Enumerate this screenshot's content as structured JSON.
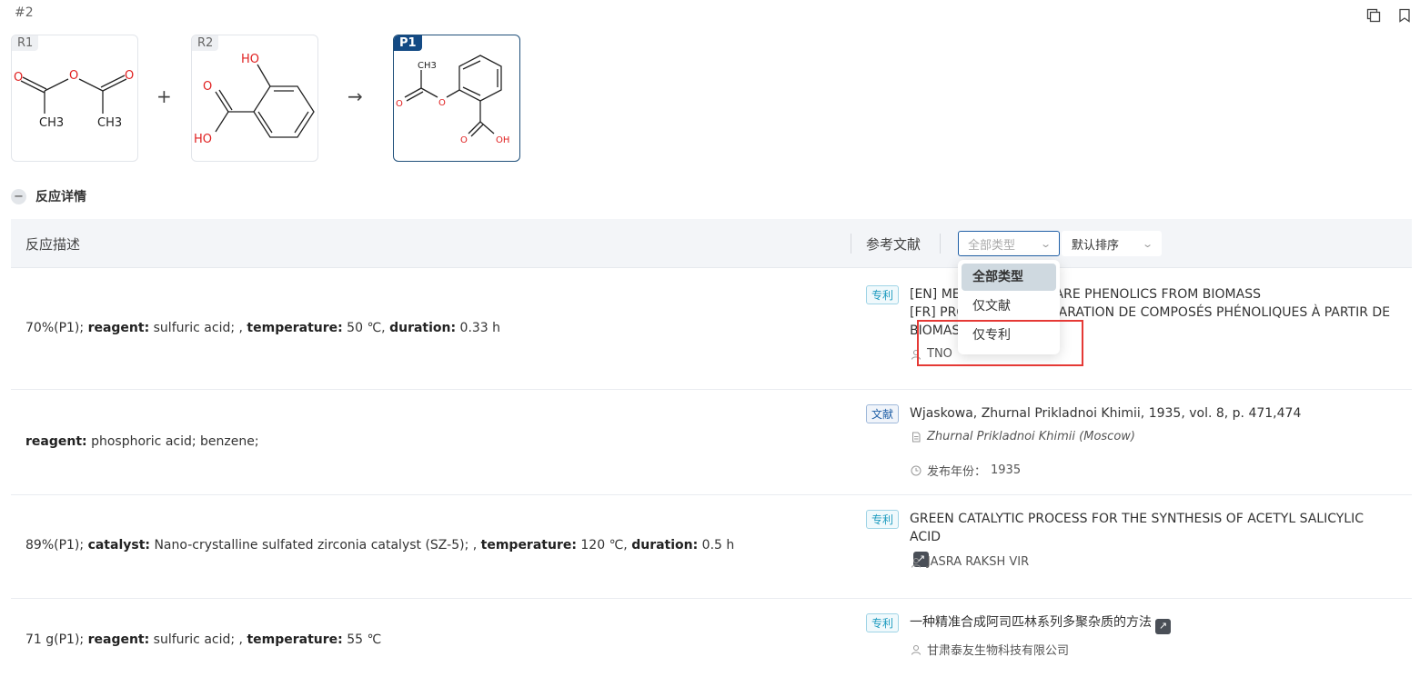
{
  "header": {
    "index": "#2",
    "copy_icon": "copy-icon",
    "bookmark_icon": "bookmark-icon"
  },
  "scheme": {
    "r1_label": "R1",
    "r2_label": "R2",
    "p1_label": "P1",
    "plus": "+",
    "arrow": "→",
    "atoms": {
      "O": "O",
      "CH3": "CH3",
      "HO": "HO",
      "OH": "OH"
    }
  },
  "section": {
    "title": "反应详情",
    "toggle_symbol": "−"
  },
  "table": {
    "col_desc": "反应描述",
    "col_ref": "参考文献",
    "type_filter_placeholder": "全部类型",
    "sort_label": "默认排序"
  },
  "dropdown": {
    "options": [
      "全部类型",
      "仅文献",
      "仅专利"
    ],
    "selected": "全部类型"
  },
  "rows": [
    {
      "desc_prefix": "70%(P1); ",
      "k1": "reagent:",
      "v1": " sulfuric acid; , ",
      "k2": "temperature:",
      "v2": " 50 ℃, ",
      "k3": "duration:",
      "v3": " 0.33 h",
      "badge": "专利",
      "title_line1": "[EN] METHOD TO PREPARE PHENOLICS FROM BIOMASS",
      "title_line2": "[FR] PROCÉDÉ DE PRÉPARATION DE COMPOSÉS PHÉNOLIQUES À PARTIR DE BIOMASSE",
      "author": "TNO"
    },
    {
      "k1": "reagent:",
      "v1": " phosphoric acid; benzene;",
      "badge": "文献",
      "title": "Wjaskowa, Zhurnal Prikladnoi Khimii, 1935, vol. 8, p. 471,474",
      "journal": "Zhurnal Prikladnoi Khimii (Moscow)",
      "year_label": "发布年份：",
      "year": "1935"
    },
    {
      "desc_prefix": "89%(P1); ",
      "k1": "catalyst:",
      "v1": " Nano-crystalline sulfated zirconia catalyst (SZ-5); , ",
      "k2": "temperature:",
      "v2": " 120 ℃, ",
      "k3": "duration:",
      "v3": " 0.5 h",
      "badge": "专利",
      "title": "GREEN CATALYTIC PROCESS FOR THE SYNTHESIS OF ACETYL SALICYLIC ACID",
      "author": "JASRA RAKSH VIR"
    },
    {
      "desc_prefix": "71 g(P1); ",
      "k1": "reagent:",
      "v1": " sulfuric acid; , ",
      "k2": "temperature:",
      "v2": " 55 ℃",
      "badge": "专利",
      "title": "一种精准合成阿司匹林系列多聚杂质的方法",
      "author": "甘肃泰友生物科技有限公司"
    }
  ],
  "colors": {
    "accent": "#134a84",
    "patent": "#1e9bbf",
    "highlight": "#e53935",
    "oxygen": "#e02020"
  }
}
